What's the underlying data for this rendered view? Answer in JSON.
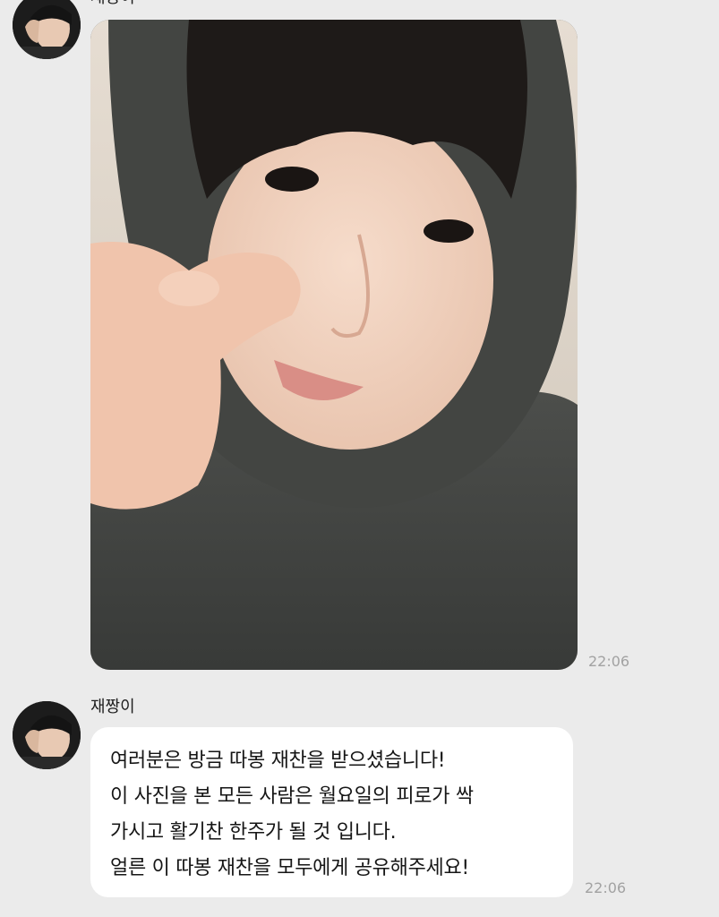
{
  "chat": {
    "messages": [
      {
        "sender": "재짱이",
        "type": "photo",
        "time": "22:06"
      },
      {
        "sender": "재짱이",
        "type": "text",
        "lines": [
          "여러분은 방금 따봉 재찬을 받으셨습니다!",
          "이 사진을 본 모든 사람은 월요일의 피로가 싹",
          "가시고 활기찬 한주가 될 것 입니다.",
          "얼른 이 따봉 재찬을 모두에게 공유해주세요!"
        ],
        "time": "22:06"
      }
    ]
  },
  "icons": {
    "avatar": "profile-avatar-icon"
  },
  "colors": {
    "background": "#ebebeb",
    "bubble": "#ffffff",
    "timestamp": "#a2a2a2",
    "text": "#161616"
  }
}
